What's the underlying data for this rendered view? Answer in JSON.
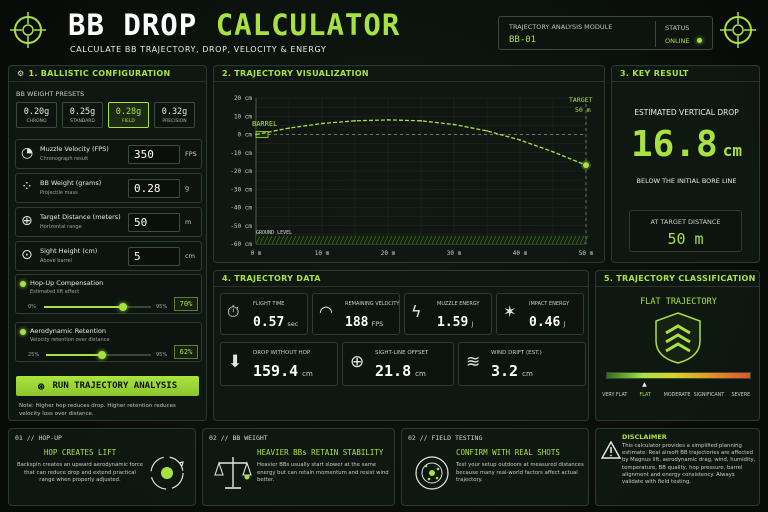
{
  "header": {
    "title_part1": "BB DROP",
    "title_part2": "CALCULATOR",
    "subtitle": "CALCULATE BB TRAJECTORY, DROP, VELOCITY & ENERGY",
    "module_label": "TRAJECTORY ANALYSIS MODULE",
    "module_id": "BB-01",
    "status_label": "STATUS",
    "status_value": "ONLINE"
  },
  "config": {
    "title": "1. BALLISTIC CONFIGURATION",
    "presets_label": "BB WEIGHT PRESETS",
    "presets": [
      {
        "value": "0.20g",
        "name": "CHRONO"
      },
      {
        "value": "0.25g",
        "name": "STANDARD"
      },
      {
        "value": "0.28g",
        "name": "FIELD",
        "selected": true
      },
      {
        "value": "0.32g",
        "name": "PRECISION"
      }
    ],
    "fields": [
      {
        "label": "Muzzle Velocity (FPS)",
        "sub": "Chronograph result",
        "value": "350",
        "unit": "FPS"
      },
      {
        "label": "BB Weight (grams)",
        "sub": "Projectile mass",
        "value": "0.28",
        "unit": "g"
      },
      {
        "label": "Target Distance (meters)",
        "sub": "Horizontal range",
        "value": "50",
        "unit": "m"
      },
      {
        "label": "Sight Height (cm)",
        "sub": "Above barrel",
        "value": "5",
        "unit": "cm"
      }
    ],
    "hopup": {
      "label": "Hop-Up Compensation",
      "sub": "Estimated lift effect",
      "min": "0%",
      "max": "95%",
      "value": "70%",
      "fraction": 0.737
    },
    "aero": {
      "label": "Aerodynamic Retention",
      "sub": "Velocity retention over distance",
      "min": "25%",
      "max": "95%",
      "value": "62%",
      "fraction": 0.529
    },
    "run_button": "RUN TRAJECTORY ANALYSIS",
    "note": "Note: Higher hop reduces drop. Higher retention reduces velocity loss over distance."
  },
  "viz": {
    "title": "2. TRAJECTORY VISUALIZATION",
    "barrel_label": "BARREL",
    "target_label": "TARGET",
    "target_distance": "50 m",
    "ground_label": "GROUND LEVEL"
  },
  "chart_data": {
    "type": "line",
    "x_ticks": [
      "0 m",
      "10 m",
      "20 m",
      "30 m",
      "40 m",
      "50 m"
    ],
    "y_ticks": [
      "20 cm",
      "10 cm",
      "0 cm",
      "-10 cm",
      "-20 cm",
      "-30 cm",
      "-40 cm",
      "-50 cm",
      "-60 cm"
    ],
    "xlim": [
      0,
      50
    ],
    "ylim": [
      -60,
      20
    ],
    "series": [
      {
        "x": [
          0,
          5,
          10,
          15,
          20,
          25,
          30,
          35,
          40,
          45,
          50
        ],
        "values": [
          0,
          3.5,
          6,
          7.5,
          8,
          7.5,
          5.5,
          2,
          -3,
          -9.5,
          -16.8
        ]
      }
    ],
    "grid": true
  },
  "key_result": {
    "title": "3. KEY RESULT",
    "label": "ESTIMATED VERTICAL DROP",
    "value": "16.8",
    "unit": "cm",
    "below": "BELOW THE INITIAL BORE LINE",
    "at_target_label": "AT TARGET DISTANCE",
    "at_target_value": "50 m"
  },
  "traj_data": {
    "title": "4. TRAJECTORY DATA",
    "row1": [
      {
        "label": "FLIGHT TIME",
        "value": "0.57",
        "unit": "sec",
        "icon": "stopwatch-icon"
      },
      {
        "label": "REMAINING VELOCITY",
        "value": "188",
        "unit": "FPS",
        "icon": "speedometer-icon"
      },
      {
        "label": "MUZZLE ENERGY",
        "value": "1.59",
        "unit": "J",
        "icon": "lightning-icon"
      },
      {
        "label": "IMPACT ENERGY",
        "value": "0.46",
        "unit": "J",
        "icon": "impact-icon"
      }
    ],
    "row2": [
      {
        "label": "DROP WITHOUT HOP",
        "value": "159.4",
        "unit": "cm",
        "icon": "arrow-down-icon"
      },
      {
        "label": "SIGHT-LINE OFFSET",
        "value": "21.8",
        "unit": "cm",
        "icon": "crosshair-icon"
      },
      {
        "label": "WIND DRIFT (EST.)",
        "value": "3.2",
        "unit": "cm",
        "icon": "wind-icon"
      }
    ]
  },
  "classification": {
    "title": "5. TRAJECTORY CLASSIFICATION",
    "label": "FLAT TRAJECTORY",
    "scale": [
      "VERY FLAT",
      "FLAT",
      "MODERATE",
      "SIGNIFICANT",
      "SEVERE"
    ],
    "pointer_fraction": 0.27
  },
  "footer": {
    "cards": [
      {
        "tag": "01 // HOP-UP",
        "title": "HOP CREATES LIFT",
        "text": "Backspin creates an upward aerodynamic force that can reduce drop and extend practical range when properly adjusted."
      },
      {
        "tag": "02 // BB WEIGHT",
        "title": "HEAVIER BBs RETAIN STABILITY",
        "text": "Heavier BBs usually start slower at the same energy but can retain momentum and resist wind better."
      },
      {
        "tag": "02 // FIELD TESTING",
        "title": "CONFIRM WITH REAL SHOTS",
        "text": "Test your setup outdoors at measured distances because many real-world factors affect actual trajectory."
      }
    ],
    "disclaimer_title": "DISCLAIMER",
    "disclaimer_text": "This calculator provides a simplified planning estimate. Real airsoft BB trajectories are affected by Magnus lift, aerodynamic drag, wind, humidity, temperature, BB quality, hop pressure, barrel alignment and energy consistency. Always validate with field testing."
  },
  "colors": {
    "accent": "#a7e241",
    "bg": "#0a0f0b"
  }
}
